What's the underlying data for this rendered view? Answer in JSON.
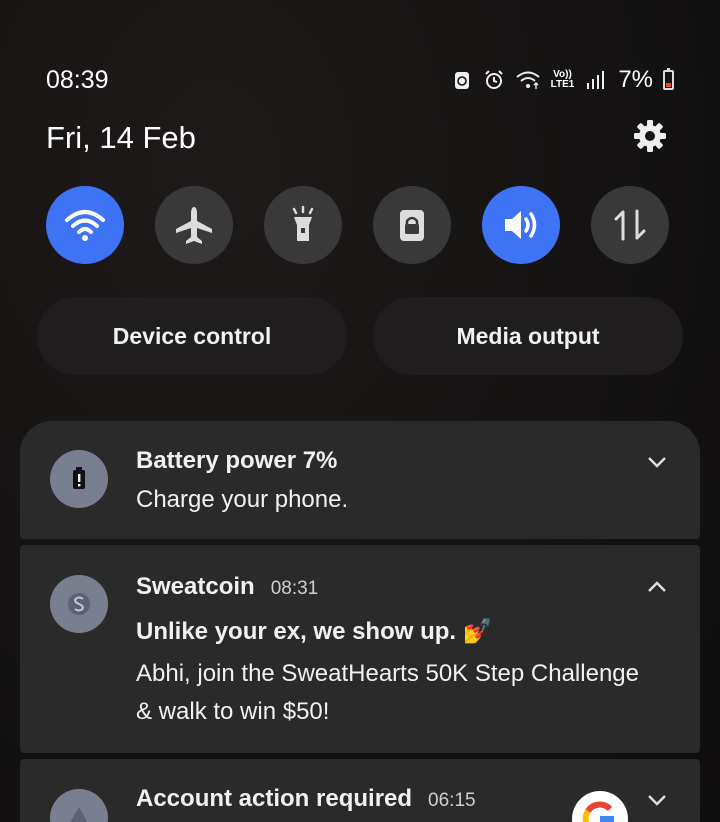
{
  "status": {
    "time": "08:39",
    "volte_line1": "Vo))",
    "volte_line2": "LTE1",
    "battery_percent": "7%"
  },
  "date": "Fri, 14 Feb",
  "toggles": [
    {
      "name": "wifi",
      "icon": "wifi-icon",
      "state": "on"
    },
    {
      "name": "airplane",
      "icon": "airplane-icon",
      "state": "off"
    },
    {
      "name": "flashlight",
      "icon": "flashlight-icon",
      "state": "off"
    },
    {
      "name": "lock",
      "icon": "lock-icon",
      "state": "off"
    },
    {
      "name": "sound",
      "icon": "sound-icon",
      "state": "on"
    },
    {
      "name": "data",
      "icon": "data-transfer-icon",
      "state": "off"
    }
  ],
  "buttons": {
    "device_control": "Device control",
    "media_output": "Media output"
  },
  "notifications": [
    {
      "title": "Battery power 7%",
      "body": "Charge your phone.",
      "icon": "battery-alert-icon"
    },
    {
      "app": "Sweatcoin",
      "time": "08:31",
      "headline": "Unlike your ex, we show up. 💅",
      "body_line1": "Abhi, join the SweatHearts 50K Step Challenge",
      "body_line2": "& walk to win $50!",
      "icon": "sweatcoin-icon"
    },
    {
      "title": "Account action required",
      "time": "06:15",
      "icon": "warning-icon"
    }
  ],
  "colors": {
    "accent_on": "#3e73f5",
    "toggle_off": "#3a3939",
    "card": "#2b2a2a",
    "battery_low": "#e9483d"
  }
}
